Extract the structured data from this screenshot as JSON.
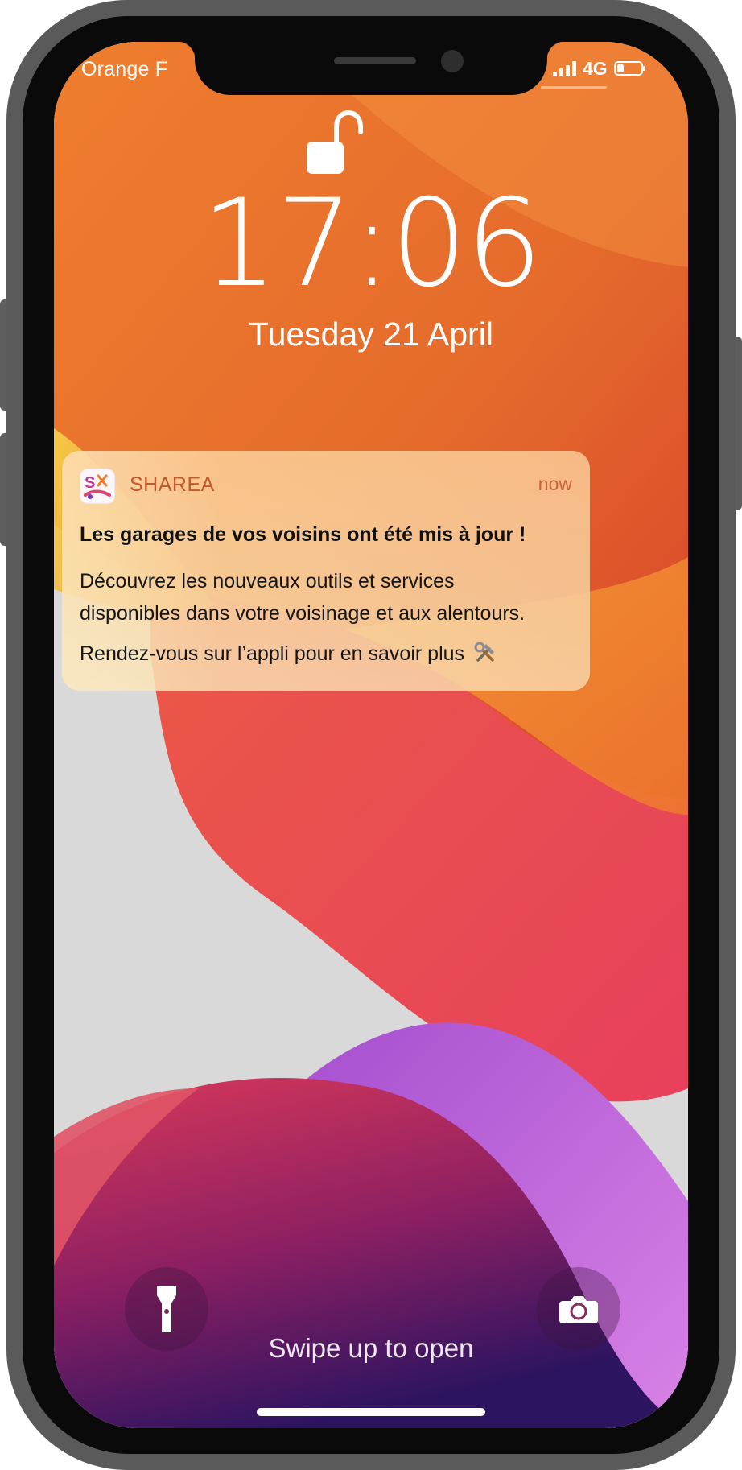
{
  "status_bar": {
    "carrier": "Orange F",
    "network": "4G",
    "battery_level": 0.3
  },
  "lock_screen": {
    "lock_state": "unlocked",
    "time": "17:06",
    "date": "Tuesday 21 April"
  },
  "notification": {
    "app_name": "SHAREA",
    "time": "now",
    "title": "Les garages de vos voisins ont été mis à jour !",
    "body_line1": "Découvrez les nouveaux outils et services",
    "body_line2": "disponibles dans votre voisinage et aux alentours.",
    "cta": "Rendez-vous sur l’appli pour en savoir plus",
    "cta_icon": "hammer-and-wrench-icon"
  },
  "bottom": {
    "swipe_hint": "Swipe up to open",
    "left_shortcut_icon": "flashlight-icon",
    "right_shortcut_icon": "camera-icon"
  },
  "colors": {
    "wallpaper_top": "#e97a2c",
    "wallpaper_red": "#e94b58",
    "wallpaper_purple": "#c46ad6",
    "wallpaper_bottom": "#2d1560",
    "wallpaper_gray": "#d9d9d9",
    "app_accent": "#c8562d"
  }
}
